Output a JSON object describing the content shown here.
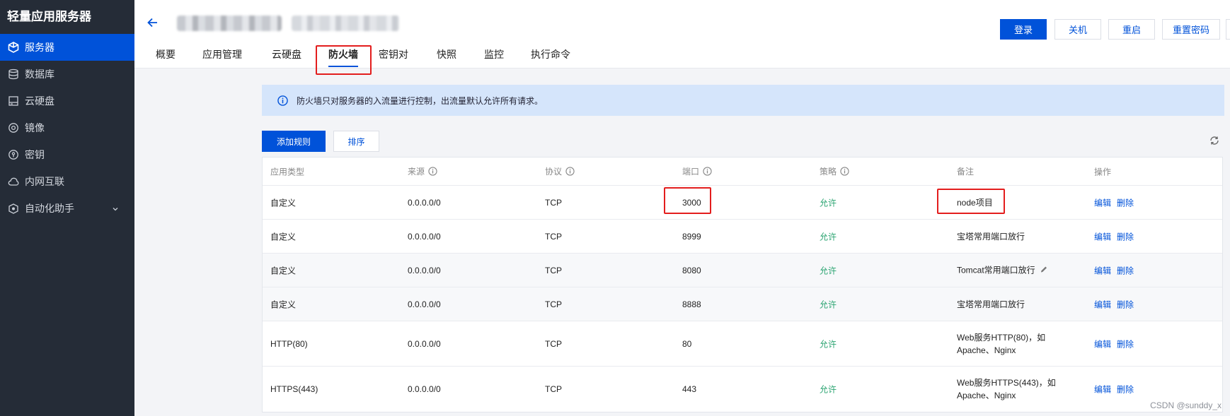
{
  "sidebar": {
    "title": "轻量应用服务器",
    "items": [
      {
        "label": "服务器",
        "icon": "cube-icon",
        "active": true
      },
      {
        "label": "数据库",
        "icon": "database-icon"
      },
      {
        "label": "云硬盘",
        "icon": "disk-icon"
      },
      {
        "label": "镜像",
        "icon": "image-icon"
      },
      {
        "label": "密钥",
        "icon": "key-icon"
      },
      {
        "label": "内网互联",
        "icon": "cloud-icon"
      },
      {
        "label": "自动化助手",
        "icon": "robot-icon",
        "expandable": true
      }
    ]
  },
  "header": {
    "buttons": {
      "login": "登录",
      "shutdown": "关机",
      "restart": "重启",
      "reset_password": "重置密码"
    },
    "tabs": [
      "概要",
      "应用管理",
      "云硬盘",
      "防火墙",
      "密钥对",
      "快照",
      "监控",
      "执行命令"
    ],
    "active_tab": "防火墙"
  },
  "notice": {
    "text": "防火墙只对服务器的入流量进行控制，出流量默认允许所有请求。"
  },
  "toolbar": {
    "add_rule": "添加规则",
    "sort": "排序"
  },
  "table": {
    "columns": [
      "应用类型",
      "来源",
      "协议",
      "端口",
      "策略",
      "备注",
      "操作"
    ],
    "rows": [
      {
        "type": "自定义",
        "source": "0.0.0.0/0",
        "protocol": "TCP",
        "port": "3000",
        "policy": "允许",
        "note": "node项目",
        "note2": ""
      },
      {
        "type": "自定义",
        "source": "0.0.0.0/0",
        "protocol": "TCP",
        "port": "8999",
        "policy": "允许",
        "note": "宝塔常用端口放行",
        "note2": ""
      },
      {
        "type": "自定义",
        "source": "0.0.0.0/0",
        "protocol": "TCP",
        "port": "8080",
        "policy": "允许",
        "note": "Tomcat常用端口放行",
        "note2": ""
      },
      {
        "type": "自定义",
        "source": "0.0.0.0/0",
        "protocol": "TCP",
        "port": "8888",
        "policy": "允许",
        "note": "宝塔常用端口放行",
        "note2": ""
      },
      {
        "type": "HTTP(80)",
        "source": "0.0.0.0/0",
        "protocol": "TCP",
        "port": "80",
        "policy": "允许",
        "note": "Web服务HTTP(80)，如",
        "note2": "Apache、Nginx"
      },
      {
        "type": "HTTPS(443)",
        "source": "0.0.0.0/0",
        "protocol": "TCP",
        "port": "443",
        "policy": "允许",
        "note": "Web服务HTTPS(443)，如",
        "note2": "Apache、Nginx"
      }
    ],
    "actions": {
      "edit": "编辑",
      "delete": "删除"
    }
  },
  "watermark": "CSDN @sunddy_x",
  "colors": {
    "primary": "#0052d9",
    "sidebar_bg": "#252c37",
    "allow": "#2ba471",
    "highlight": "#e31d1d"
  }
}
